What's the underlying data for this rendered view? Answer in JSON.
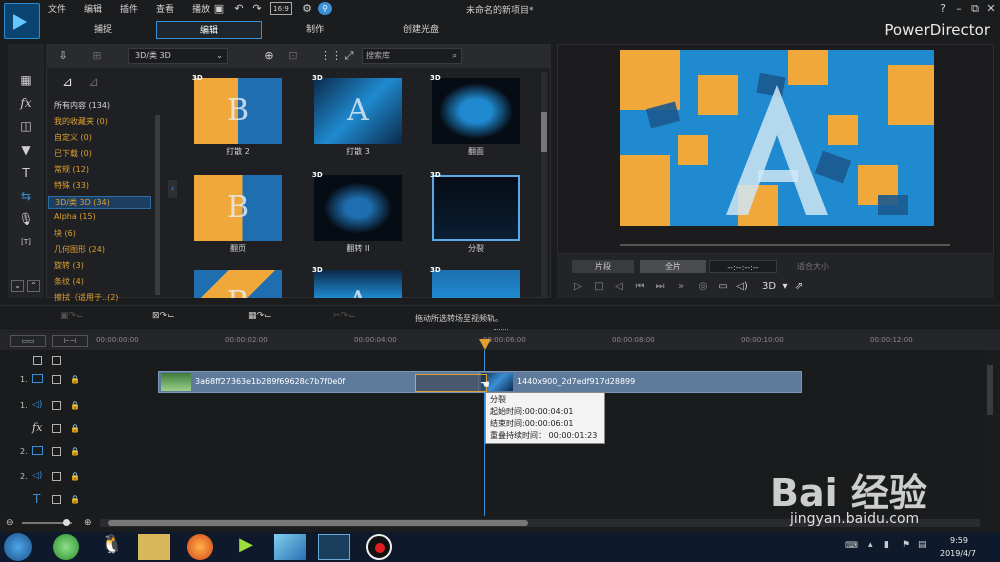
{
  "menu": [
    "文件",
    "编辑",
    "插件",
    "查看",
    "播放"
  ],
  "window_title": "未命名的新项目*",
  "help": "?",
  "brand": "PowerDirector",
  "tabs": [
    {
      "label": "捕捉",
      "active": false
    },
    {
      "label": "编辑",
      "active": true
    },
    {
      "label": "制作",
      "active": false
    },
    {
      "label": "创建光盘",
      "active": false
    }
  ],
  "library": {
    "dropdown": "3D/类 3D",
    "search_placeholder": "搜索库",
    "categories": [
      {
        "label": "所有内容 (134)",
        "selected": false,
        "color": "#d8d8d8"
      },
      {
        "label": "我的收藏夹 (0)",
        "selected": false
      },
      {
        "label": "自定义 (0)",
        "selected": false
      },
      {
        "label": "已下载 (0)",
        "selected": false
      },
      {
        "label": "常规 (12)",
        "selected": false
      },
      {
        "label": "特殊 (33)",
        "selected": false
      },
      {
        "label": "3D/类 3D (34)",
        "selected": true
      },
      {
        "label": "Alpha (15)",
        "selected": false
      },
      {
        "label": "块 (6)",
        "selected": false
      },
      {
        "label": "几何图形 (24)",
        "selected": false
      },
      {
        "label": "旋转 (3)",
        "selected": false
      },
      {
        "label": "条纹 (4)",
        "selected": false
      },
      {
        "label": "擦拭（适用于..(2)",
        "selected": false
      }
    ],
    "thumbs": [
      {
        "label": "打散 2",
        "badge": "3D"
      },
      {
        "label": "打散 3",
        "badge": "3D"
      },
      {
        "label": "翻面",
        "badge": "3D"
      },
      {
        "label": "翻页",
        "badge": ""
      },
      {
        "label": "翻转 II",
        "badge": "3D"
      },
      {
        "label": "分裂",
        "badge": "3D"
      },
      {
        "label": "",
        "badge": ""
      },
      {
        "label": "",
        "badge": "3D"
      },
      {
        "label": "",
        "badge": "3D"
      }
    ]
  },
  "preview": {
    "segment_btn": "片段",
    "full_btn": "全片",
    "timecode": "--:--:--:--",
    "fit": "适合大小",
    "mode_3d": "3D"
  },
  "timeline": {
    "hint": "拖动所选转场至视频轨。",
    "ruler": [
      "00:00:00:00",
      "00:00:02:00",
      "00:00:04:00",
      "00:00:06:00",
      "00:00:08:00",
      "00:00:10:00",
      "00:00:12:00"
    ],
    "track_nums": [
      "1.",
      "1.",
      "2.",
      "2."
    ],
    "clip1": "3a68ff27363e1b289f69628c7b7f0e0f",
    "clip2": "1440x900_2d7edf917d28899",
    "tooltip": {
      "title": "分裂",
      "start": "起始时间:00:00:04:01",
      "end": "结束时间:00:00:06:01",
      "overlap": "重叠持续时间： 00:00:01:23"
    }
  },
  "taskbar": {
    "time": "9:59",
    "date": "2019/4/7"
  },
  "watermark": {
    "text": "Bai 经验",
    "url": "jingyan.baidu.com"
  },
  "colors": {
    "accent": "#3b8fd6",
    "orange": "#e0a030",
    "clip": "#5e7b9c",
    "preview_blue": "#1f8ad0",
    "preview_orange": "#f0a83a"
  }
}
